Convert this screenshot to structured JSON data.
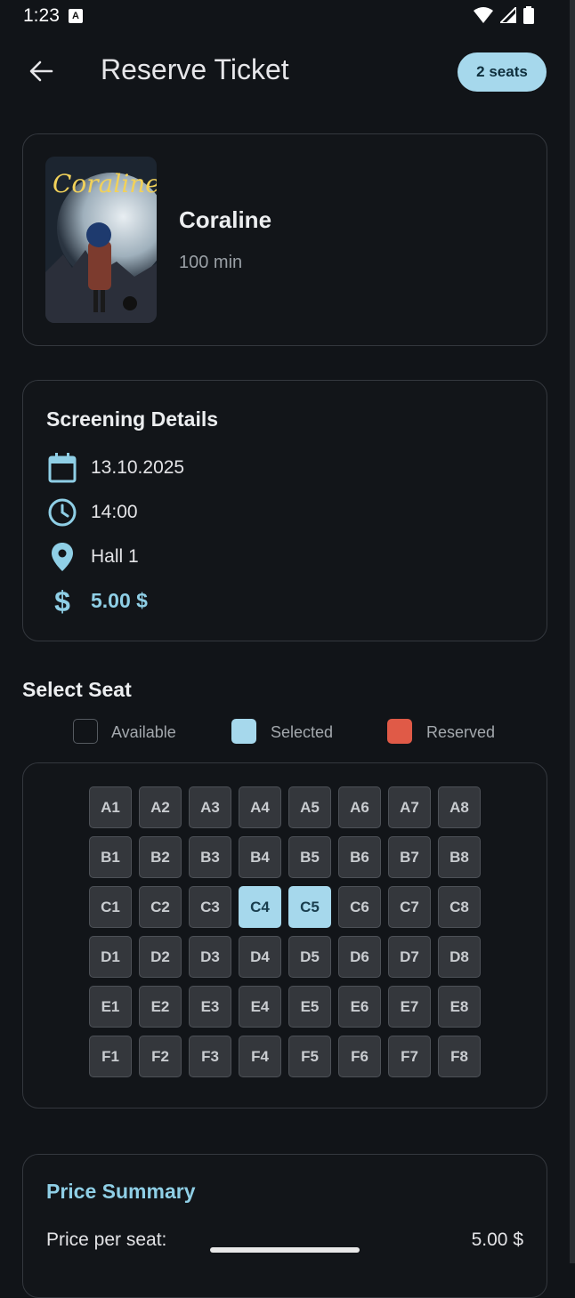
{
  "status_bar": {
    "time": "1:23",
    "notification_letter": "A"
  },
  "app_bar": {
    "title": "Reserve Ticket",
    "seats_badge": "2 seats"
  },
  "movie": {
    "title": "Coraline",
    "duration": "100 min",
    "poster_text": "Coraline"
  },
  "screening": {
    "heading": "Screening Details",
    "date": "13.10.2025",
    "time": "14:00",
    "hall": "Hall 1",
    "price": "5.00 $"
  },
  "seat_selection": {
    "heading": "Select Seat",
    "legend": {
      "available": "Available",
      "selected": "Selected",
      "reserved": "Reserved"
    },
    "rows": [
      "A",
      "B",
      "C",
      "D",
      "E",
      "F"
    ],
    "columns": 8,
    "selected_seats": [
      "C4",
      "C5"
    ],
    "reserved_seats": []
  },
  "summary": {
    "heading": "Price Summary",
    "price_per_seat_label": "Price per seat:",
    "price_per_seat_value": "5.00 $"
  },
  "colors": {
    "accent": "#a6d8ec",
    "reserved": "#e05a47",
    "background": "#111418"
  }
}
